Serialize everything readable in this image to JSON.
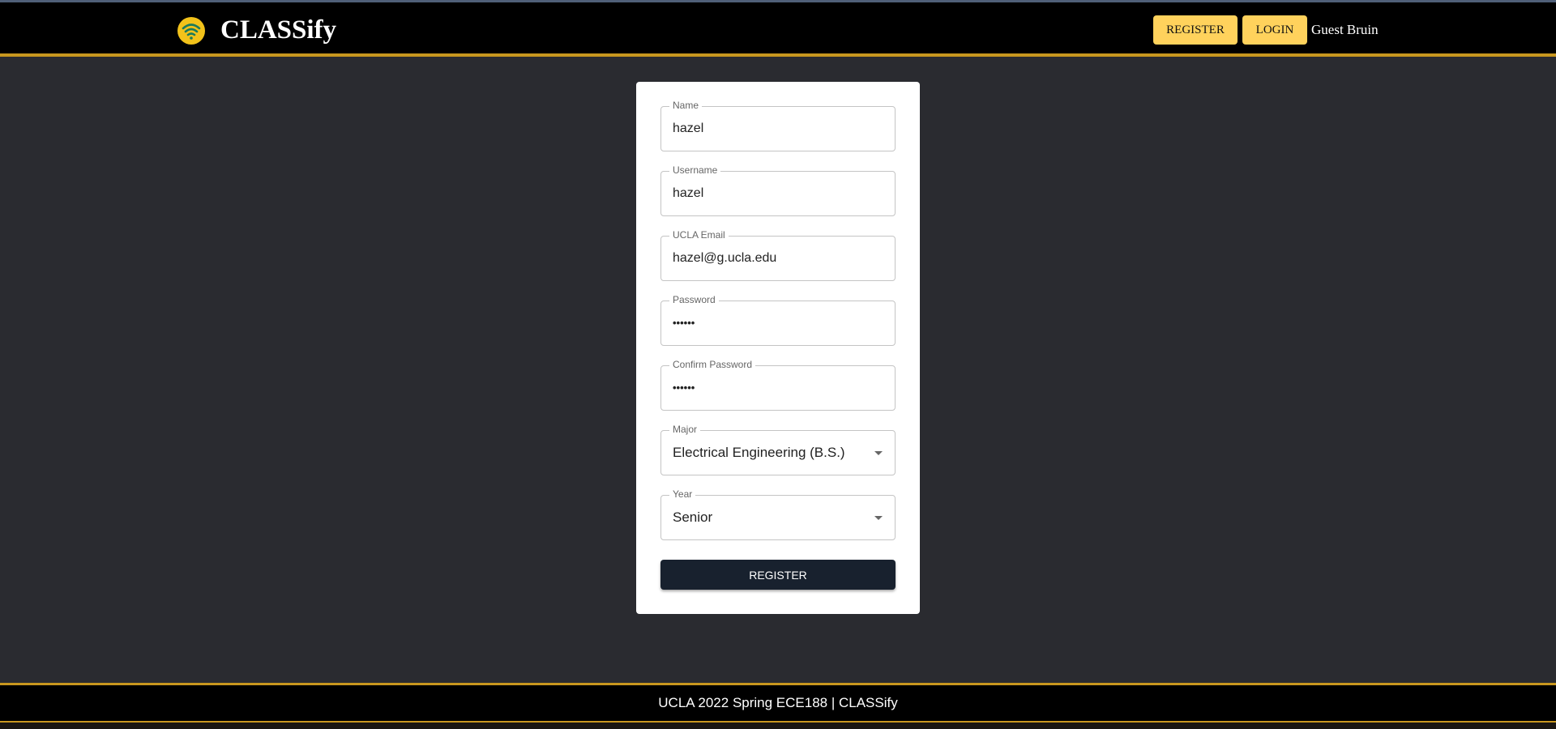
{
  "header": {
    "brand": "CLASSify",
    "register_label": "REGISTER",
    "login_label": "LOGIN",
    "user_label": "Guest Bruin",
    "logo_icon": "wifi-signal-icon"
  },
  "form": {
    "name": {
      "label": "Name",
      "value": "hazel"
    },
    "username": {
      "label": "Username",
      "value": "hazel"
    },
    "email": {
      "label": "UCLA Email",
      "value": "hazel@g.ucla.edu"
    },
    "password": {
      "label": "Password",
      "value": "••••••"
    },
    "confirm_password": {
      "label": "Confirm Password",
      "value": "••••••"
    },
    "major": {
      "label": "Major",
      "value": "Electrical Engineering (B.S.)"
    },
    "year": {
      "label": "Year",
      "value": "Senior"
    },
    "submit_label": "REGISTER"
  },
  "footer": {
    "text": "UCLA 2022 Spring ECE188 | CLASSify"
  },
  "colors": {
    "background": "#2a2b30",
    "header": "#000000",
    "accent_gold": "#c8971f",
    "button_yellow": "#ffd25c",
    "submit_navy": "#18212e"
  }
}
